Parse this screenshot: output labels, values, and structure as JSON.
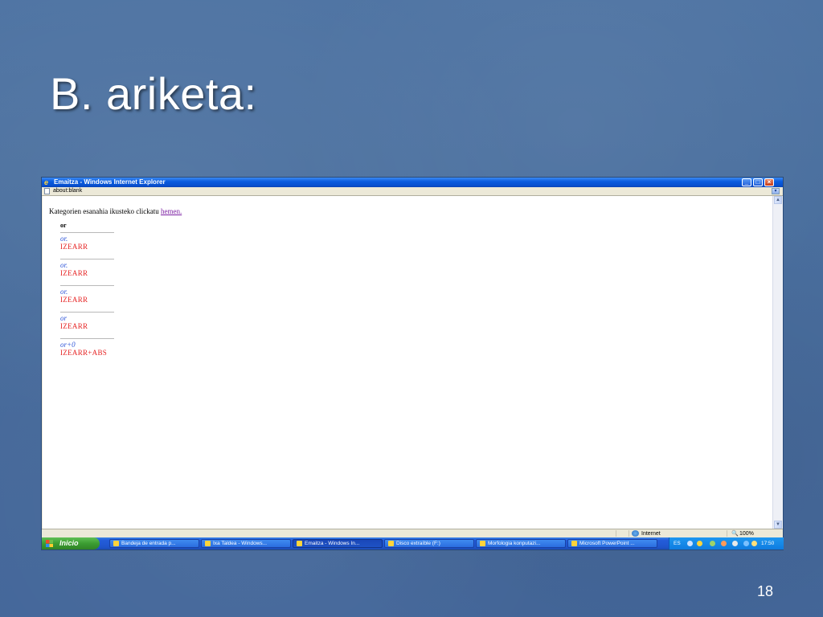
{
  "slide": {
    "title": "B. ariketa:",
    "page_number": "18"
  },
  "window": {
    "title": "Emaitza - Windows Internet Explorer",
    "minimize": "_",
    "maximize": "□",
    "close": "×",
    "address": "about:blank",
    "address_dropdown": "▾"
  },
  "content": {
    "intro_text": "Kategorien esanahia ikusteko clickatu ",
    "intro_link": "hemen.",
    "header": "or",
    "entries": [
      {
        "morph": "or.",
        "category": "IZEARR"
      },
      {
        "morph": "or.",
        "category": "IZEARR"
      },
      {
        "morph": "or.",
        "category": "IZEARR"
      },
      {
        "morph": "or",
        "category": "IZEARR"
      },
      {
        "morph": "or+0",
        "category": "IZEARR+ABS"
      }
    ]
  },
  "statusbar": {
    "zone": "Internet",
    "zoom": "100%"
  },
  "taskbar": {
    "start_label": "Inicio",
    "tasks": [
      "Bandeja de entrada p...",
      "Ixa Taldea - Windows...",
      "Emaitza - Windows In...",
      "Disco extraíble (F:)",
      "Morfologia konputazi...",
      "Microsoft PowerPoint ..."
    ],
    "language": "ES",
    "clock": "17:50"
  },
  "colors": {
    "slide_bg": "#4a6f9e",
    "xp_title_blue": "#0a5ce0",
    "morph_blue": "#3056d8",
    "category_red": "#e62222",
    "link_purple": "#7b1fa2"
  }
}
